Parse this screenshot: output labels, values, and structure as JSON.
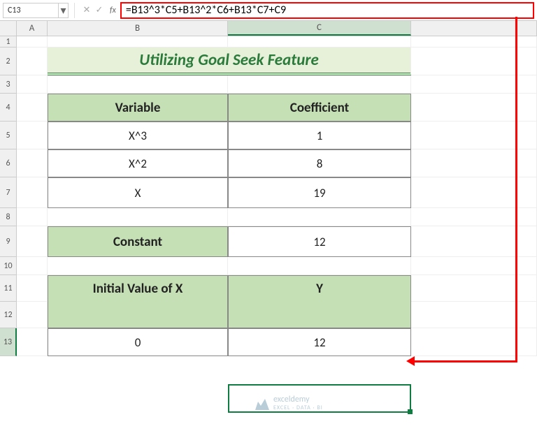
{
  "name_box": "C13",
  "formula": "=B13^3*C5+B13^2*C6+B13*C7+C9",
  "cols": {
    "A": "A",
    "B": "B",
    "C": "C"
  },
  "rows": [
    "1",
    "2",
    "3",
    "4",
    "5",
    "6",
    "7",
    "8",
    "9",
    "10",
    "11",
    "12",
    "13"
  ],
  "title": "Utilizing Goal Seek Feature",
  "table1": {
    "h1": "Variable",
    "h2": "Coefficient",
    "r1c1": "X^3",
    "r1c2": "1",
    "r2c1": "X^2",
    "r2c2": "8",
    "r3c1": "X",
    "r3c2": "19"
  },
  "table2": {
    "h1": "Constant",
    "v1": "12"
  },
  "table3": {
    "h1": "Initial Value of X",
    "h2": "Y",
    "v1": "0",
    "v2": "12"
  },
  "watermark": {
    "name": "exceldemy",
    "tag": "EXCEL · DATA · BI"
  },
  "selected_cell": "C13"
}
